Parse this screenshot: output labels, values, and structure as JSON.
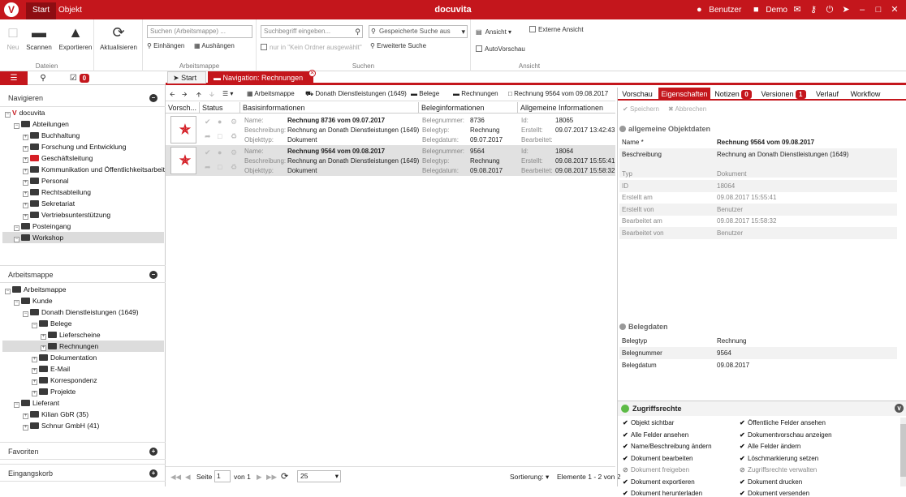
{
  "titlebar": {
    "tabs": [
      "Start",
      "Objekt"
    ],
    "title": "docuvita",
    "user": "Benutzer",
    "org": "Demo"
  },
  "ribbon": {
    "dateien": {
      "label": "Dateien",
      "neu": "Neu",
      "scannen": "Scannen",
      "exportieren": "Exportieren"
    },
    "aktualisieren": "Aktualisieren",
    "arbeitsmappe": {
      "label": "Arbeitsmappe",
      "search_placeholder": "Suchen (Arbeitsmappe) ...",
      "einhaengen": "Einhängen",
      "aushaengen": "Aushängen"
    },
    "suchen": {
      "label": "Suchen",
      "term_placeholder": "Suchbegriff eingeben...",
      "only_folder": "nur in \"Kein Ordner ausgewählt\"",
      "saved_search": "Gespeicherte Suche aus",
      "extended": "Erweiterte Suche"
    },
    "ansicht": {
      "label": "Ansicht",
      "ansicht": "Ansicht",
      "externe": "Externe Ansicht",
      "autovorschau": "AutoVorschau"
    }
  },
  "left": {
    "badge": "0",
    "navigieren": "Navigieren",
    "nav_tree": [
      {
        "label": "docuvita",
        "level": 0,
        "type": "root"
      },
      {
        "label": "Abteilungen",
        "level": 1,
        "type": "folder"
      },
      {
        "label": "Buchhaltung",
        "level": 2,
        "type": "folder"
      },
      {
        "label": "Forschung und Entwicklung",
        "level": 2,
        "type": "folder"
      },
      {
        "label": "Geschäftsleitung",
        "level": 2,
        "type": "red"
      },
      {
        "label": "Kommunikation und Öffentlichkeitsarbeit",
        "level": 2,
        "type": "folder"
      },
      {
        "label": "Personal",
        "level": 2,
        "type": "folder"
      },
      {
        "label": "Rechtsabteilung",
        "level": 2,
        "type": "folder"
      },
      {
        "label": "Sekretariat",
        "level": 2,
        "type": "folder"
      },
      {
        "label": "Vertriebsunterstützung",
        "level": 2,
        "type": "folder"
      },
      {
        "label": "Posteingang",
        "level": 1,
        "type": "folder"
      },
      {
        "label": "Workshop",
        "level": 1,
        "type": "folder"
      }
    ],
    "arbeitsmappe": "Arbeitsmappe",
    "am_tree": [
      {
        "label": "Arbeitsmappe",
        "level": 0
      },
      {
        "label": "Kunde",
        "level": 1
      },
      {
        "label": "Donath Dienstleistungen (1649)",
        "level": 2
      },
      {
        "label": "Belege",
        "level": 3
      },
      {
        "label": "Lieferscheine",
        "level": 4
      },
      {
        "label": "Rechnungen",
        "level": 4
      },
      {
        "label": "Dokumentation",
        "level": 3
      },
      {
        "label": "E-Mail",
        "level": 3
      },
      {
        "label": "Korrespondenz",
        "level": 3
      },
      {
        "label": "Projekte",
        "level": 3
      },
      {
        "label": "Lieferant",
        "level": 1
      },
      {
        "label": "Kilian GbR (35)",
        "level": 2
      },
      {
        "label": "Schnur GmbH (41)",
        "level": 2
      }
    ],
    "favoriten": "Favoriten",
    "eingangskorb": "Eingangskorb"
  },
  "doctabs": {
    "start": "Start",
    "nav": "Navigation: Rechnungen"
  },
  "breadcrumb": [
    "Arbeitsmappe",
    "Donath Dienstleistungen (1649)",
    "Belege",
    "Rechnungen",
    "Rechnung 9564 vom 09.08.2017"
  ],
  "grid": {
    "headers": [
      "Vorsch...",
      "Status",
      "Basisinformationen",
      "Beleginformationen",
      "Allgemeine Informationen"
    ],
    "labels": {
      "name": "Name:",
      "beschreibung": "Beschreibung:",
      "objekttyp": "Objekttyp:",
      "belegnummer": "Belegnummer:",
      "belegtyp": "Belegtyp:",
      "belegdatum": "Belegdatum:",
      "id": "Id:",
      "erstellt": "Erstellt:",
      "bearbeitet": "Bearbeitet:"
    },
    "rows": [
      {
        "name": "Rechnung 8736 vom 09.07.2017",
        "beschreibung": "Rechnung an Donath Dienstleistungen (1649)",
        "objekttyp": "Dokument",
        "belegnummer": "8736",
        "belegtyp": "Rechnung",
        "belegdatum": "09.07.2017",
        "id": "18065",
        "erstellt": "09.07.2017 13:42:43",
        "bearbeitet": ""
      },
      {
        "name": "Rechnung 9564 vom 09.08.2017",
        "beschreibung": "Rechnung an Donath Dienstleistungen (1649)",
        "objekttyp": "Dokument",
        "belegnummer": "9564",
        "belegtyp": "Rechnung",
        "belegdatum": "09.08.2017",
        "id": "18064",
        "erstellt": "09.08.2017 15:55:41",
        "bearbeitet": "09.08.2017 15:58:32"
      }
    ]
  },
  "pager": {
    "seite": "Seite",
    "page": "1",
    "von": "von 1",
    "size": "25",
    "sortierung": "Sortierung:",
    "elemente": "Elemente 1 - 2 von 2"
  },
  "rpanel": {
    "tabs": [
      {
        "label": "Vorschau"
      },
      {
        "label": "Eigenschaften"
      },
      {
        "label": "Notizen",
        "badge": "0"
      },
      {
        "label": "Versionen",
        "badge": "1"
      },
      {
        "label": "Verlauf"
      },
      {
        "label": "Workflow"
      }
    ],
    "speichern": "Speichern",
    "abbrechen": "Abbrechen",
    "sec1": "allgemeine Objektdaten",
    "props1": [
      {
        "k": "Name *",
        "v": "Rechnung 9564 vom 09.08.2017",
        "bold": true
      },
      {
        "k": "Beschreibung",
        "v": "Rechnung an Donath Dienstleistungen (1649)"
      },
      {
        "k": "Typ",
        "v": "Dokument",
        "ro": true
      },
      {
        "k": "ID",
        "v": "18064",
        "ro": true
      },
      {
        "k": "Erstellt am",
        "v": "09.08.2017 15:55:41",
        "ro": true
      },
      {
        "k": "Erstellt von",
        "v": "Benutzer",
        "ro": true
      },
      {
        "k": "Bearbeitet am",
        "v": "09.08.2017 15:58:32",
        "ro": true
      },
      {
        "k": "Bearbeitet von",
        "v": "Benutzer",
        "ro": true
      }
    ],
    "sec2": "Belegdaten",
    "props2": [
      {
        "k": "Belegtyp",
        "v": "Rechnung"
      },
      {
        "k": "Belegnummer",
        "v": "9564"
      },
      {
        "k": "Belegdatum",
        "v": "09.08.2017"
      }
    ],
    "zugriff": "Zugriffsrechte",
    "perms_left": [
      {
        "t": "Objekt sichtbar",
        "on": true
      },
      {
        "t": "Alle Felder ansehen",
        "on": true
      },
      {
        "t": "Name/Beschreibung ändern",
        "on": true
      },
      {
        "t": "Dokument bearbeiten",
        "on": true
      },
      {
        "t": "Dokument freigeben",
        "on": false
      },
      {
        "t": "Dokument exportieren",
        "on": true
      },
      {
        "t": "Dokument herunterladen",
        "on": true
      }
    ],
    "perms_right": [
      {
        "t": "Öffentliche Felder ansehen",
        "on": true
      },
      {
        "t": "Dokumentvorschau anzeigen",
        "on": true
      },
      {
        "t": "Alle Felder ändern",
        "on": true
      },
      {
        "t": "Löschmarkierung setzen",
        "on": true
      },
      {
        "t": "Zugriffsrechte verwalten",
        "on": false
      },
      {
        "t": "Dokument drucken",
        "on": true
      },
      {
        "t": "Dokument versenden",
        "on": true
      }
    ]
  }
}
